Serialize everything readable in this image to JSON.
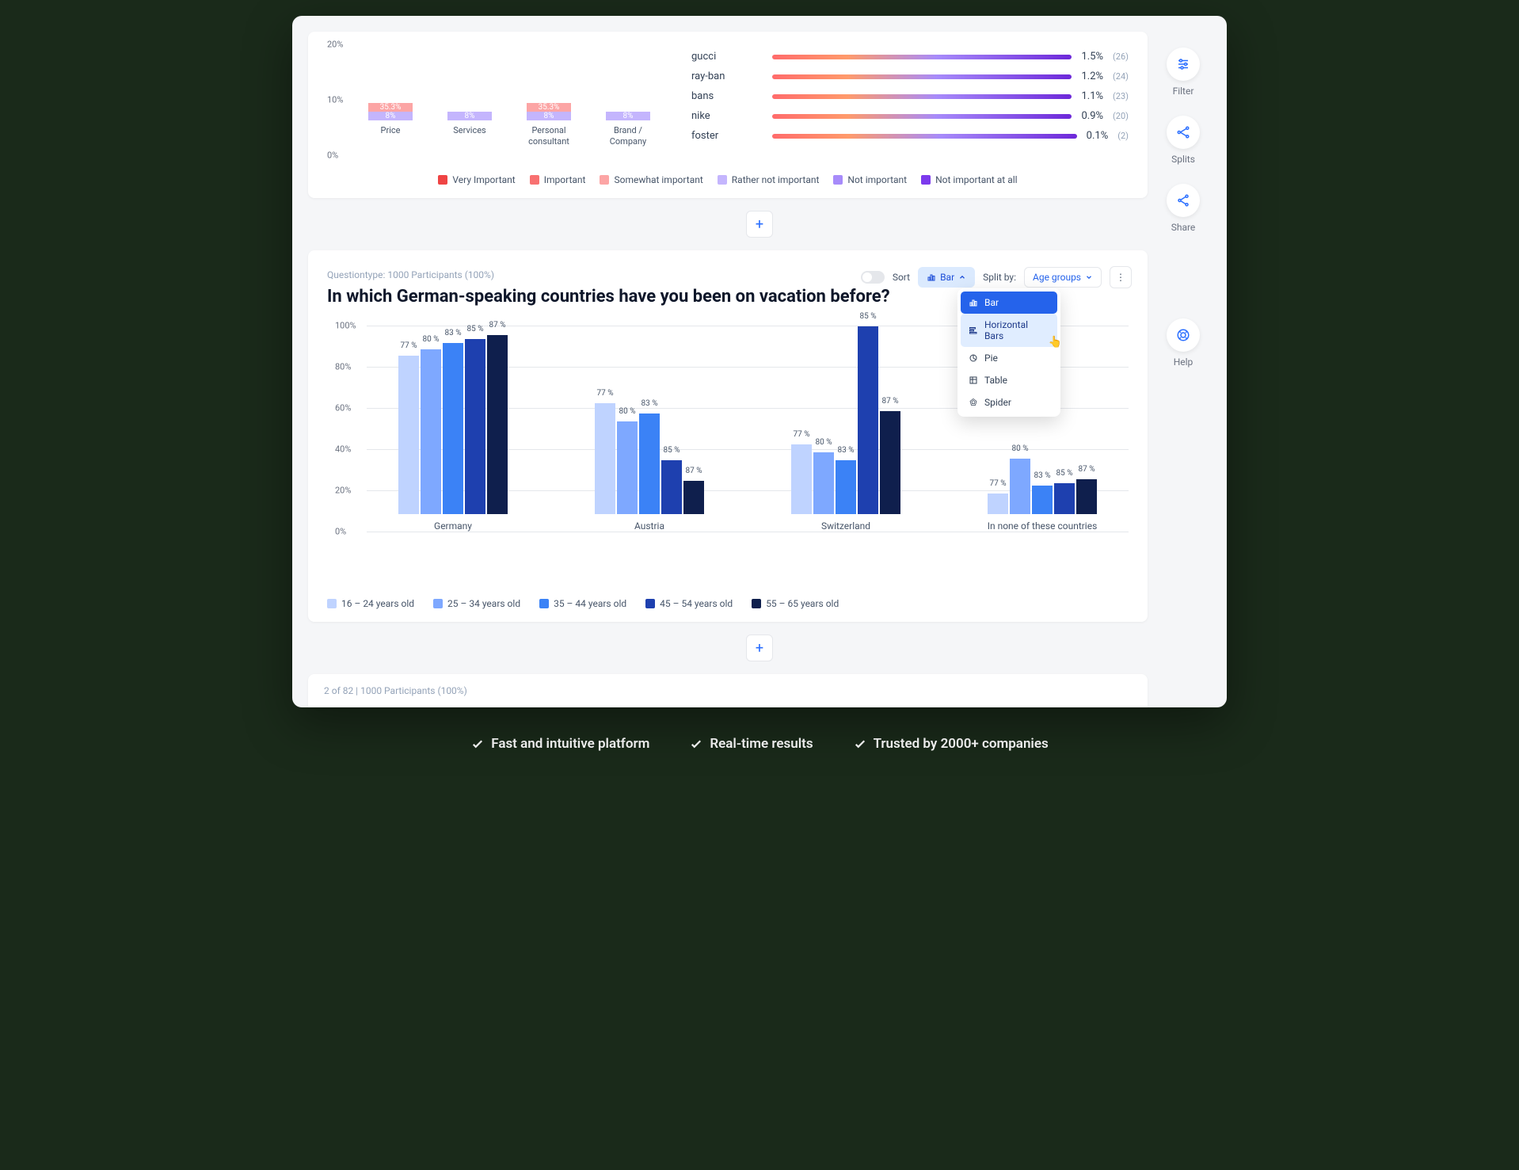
{
  "sidebar": {
    "filter": "Filter",
    "splits": "Splits",
    "share": "Share",
    "help": "Help"
  },
  "top_chart": {
    "y_ticks": [
      "20%",
      "10%",
      "0%"
    ],
    "categories": [
      "Price",
      "Services",
      "Personal consultant",
      "Brand / Company"
    ],
    "labels_visible": {
      "price_somewhat": "35.3%",
      "price_rather": "8%",
      "services_rather": "8%",
      "personal_somewhat": "35.3%",
      "personal_rather": "8%",
      "brand_rather": "8%"
    },
    "legend": [
      "Very Important",
      "Important",
      "Somewhat important",
      "Rather not important",
      "Not important",
      "Not important at all"
    ],
    "legend_colors": [
      "#ef4444",
      "#f87171",
      "#fca5a5",
      "#c4b5fd",
      "#a78bfa",
      "#7c3aed"
    ]
  },
  "brands": [
    {
      "name": "gucci",
      "pct": "1.5%",
      "count": "(26)"
    },
    {
      "name": "ray-ban",
      "pct": "1.2%",
      "count": "(24)"
    },
    {
      "name": "bans",
      "pct": "1.1%",
      "count": "(23)"
    },
    {
      "name": "nike",
      "pct": "0.9%",
      "count": "(20)"
    },
    {
      "name": "foster",
      "pct": "0.1%",
      "count": "(2)"
    }
  ],
  "question_card": {
    "meta": "Questiontype: 1000 Participants (100%)",
    "title": "In which German-speaking countries have you been on vacation before?",
    "sort_label": "Sort",
    "bar_chip": "Bar",
    "splitby_label": "Split by:",
    "splitby_value": "Age groups",
    "dropdown": [
      "Bar",
      "Horizontal Bars",
      "Pie",
      "Table",
      "Spider"
    ]
  },
  "chart_data": {
    "type": "bar",
    "title": "In which German-speaking countries have you been on vacation before?",
    "xlabel": "",
    "ylabel": "",
    "ylim": [
      0,
      100
    ],
    "y_ticks": [
      "100%",
      "80%",
      "60%",
      "40%",
      "20%",
      "0%"
    ],
    "categories": [
      "Germany",
      "Austria",
      "Switzerland",
      "In none of these countries"
    ],
    "series": [
      {
        "name": "16 – 24 years old",
        "color": "#bfd3ff",
        "values": [
          77,
          77,
          77,
          77
        ],
        "labels": [
          "77 %",
          "77 %",
          "77 %",
          "77 %"
        ],
        "heights": [
          77,
          54,
          34,
          10
        ]
      },
      {
        "name": "25 – 34 years old",
        "color": "#7ea8ff",
        "values": [
          80,
          80,
          80,
          80
        ],
        "labels": [
          "80 %",
          "80 %",
          "80 %",
          "80 %"
        ],
        "heights": [
          80,
          45,
          30,
          27
        ]
      },
      {
        "name": "35 – 44 years old",
        "color": "#3b82f6",
        "values": [
          83,
          83,
          83,
          83
        ],
        "labels": [
          "83 %",
          "83 %",
          "83 %",
          "83 %"
        ],
        "heights": [
          83,
          49,
          26,
          14
        ]
      },
      {
        "name": "45 – 54 years old",
        "color": "#1e40af",
        "values": [
          85,
          85,
          85,
          85
        ],
        "labels": [
          "85 %",
          "85 %",
          "85 %",
          "85 %"
        ],
        "heights": [
          85,
          26,
          91,
          15
        ]
      },
      {
        "name": "55 – 65 years old",
        "color": "#0f1f4d",
        "values": [
          87,
          87,
          87,
          87
        ],
        "labels": [
          "87 %",
          "87 %",
          "87 %",
          "87 %"
        ],
        "heights": [
          87,
          16,
          50,
          17
        ]
      }
    ]
  },
  "pager": "2 of 82 | 1000 Participants (100%)",
  "footer": [
    "Fast and intuitive platform",
    "Real-time results",
    "Trusted by 2000+ companies"
  ]
}
